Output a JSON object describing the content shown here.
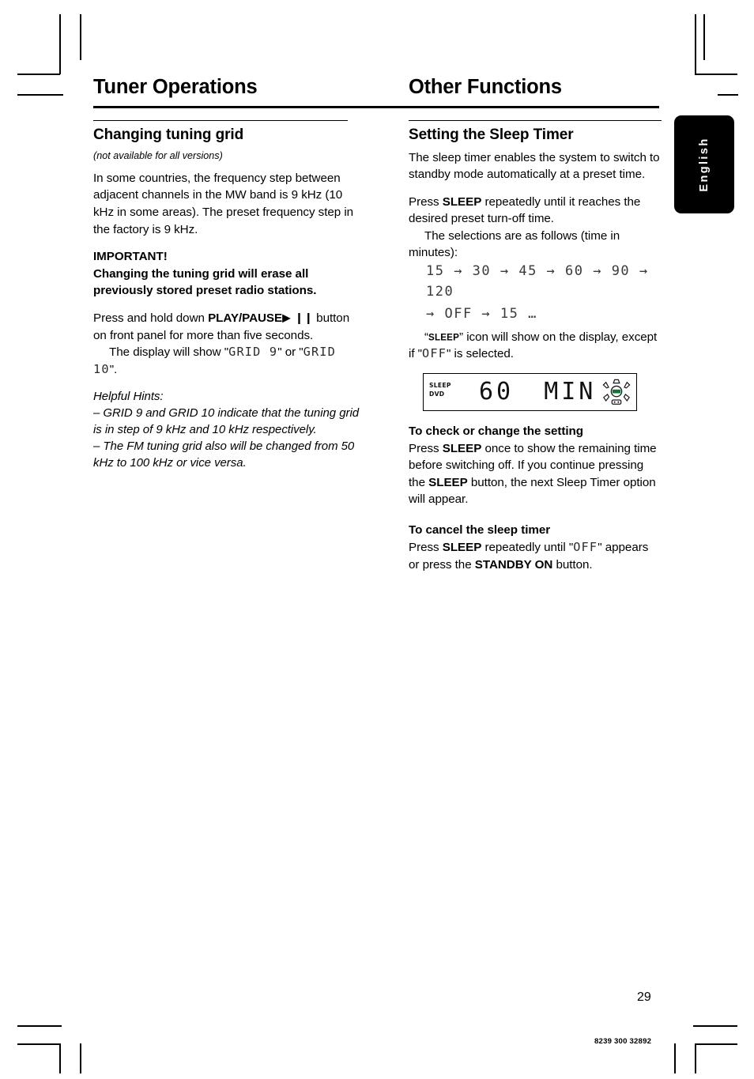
{
  "document": {
    "page_number": "29",
    "doc_code": "8239 300 32892",
    "language_tab": "English"
  },
  "left_column": {
    "section_title": "Tuner Operations",
    "subhead": "Changing tuning grid",
    "note": "(not available for all versions)",
    "paragraph_1": "In some countries, the frequency step between adjacent channels in the MW band is 9 kHz (10 kHz in some areas). The preset frequency step in the factory is 9 kHz.",
    "important_label": "IMPORTANT!",
    "important_text": "Changing the tuning grid will erase all previously stored preset radio stations.",
    "press_hold_prefix": "Press and hold down ",
    "press_hold_button": "PLAY/PAUSE",
    "press_hold_symbols": "▶ ❙❙",
    "press_hold_suffix": " button on front panel for more than five seconds.",
    "display_show_prefix": "The display will show \"",
    "display_show_value_1": "GRID 9",
    "display_show_mid": "\" or \"",
    "display_show_value_2": "GRID 10",
    "display_show_suffix": "\".",
    "hints_label": "Helpful Hints:",
    "hint_1": "– GRID 9 and GRID 10 indicate that the tuning grid is in step of 9 kHz and 10 kHz respectively.",
    "hint_2": "– The FM tuning grid also will be changed from 50 kHz to 100 kHz or vice versa."
  },
  "right_column": {
    "section_title": "Other Functions",
    "subhead": "Setting the Sleep Timer",
    "paragraph_1": "The sleep timer enables the system to switch to standby mode automatically at a preset time.",
    "press_sleep_prefix": "Press ",
    "press_sleep_button": "SLEEP",
    "press_sleep_suffix": " repeatedly until it reaches the desired preset turn-off time.",
    "selections_text": "The selections are as follows (time in minutes):",
    "sleep_sequence_line_1": "15 → 30 → 45 → 60 → 90 →  120",
    "sleep_sequence_line_2": "→ OFF →  15 …",
    "icon_note_prefix": "“",
    "icon_note_badge": "SLEEP",
    "icon_note_mid": "” icon will show on the display, except if \"",
    "icon_note_value": "OFF",
    "icon_note_suffix": "\" is selected.",
    "display_panel": {
      "indicator_sleep": "SLEEP",
      "indicator_dvd": "DVD",
      "main_value": "60",
      "main_unit": "MIN",
      "icon_label": "SURR"
    },
    "check_heading": "To check or change the setting",
    "check_prefix": "Press ",
    "check_button_1": "SLEEP",
    "check_mid": " once to show the remaining time before switching off. If you continue pressing the ",
    "check_button_2": "SLEEP",
    "check_suffix": " button, the next Sleep Timer option will appear.",
    "cancel_heading": "To cancel the sleep timer",
    "cancel_prefix": "Press ",
    "cancel_button_1": "SLEEP",
    "cancel_mid": " repeatedly until \"",
    "cancel_value": "OFF",
    "cancel_mid_2": "\" appears or press the ",
    "cancel_button_2": "STANDBY ON",
    "cancel_suffix": " button."
  }
}
